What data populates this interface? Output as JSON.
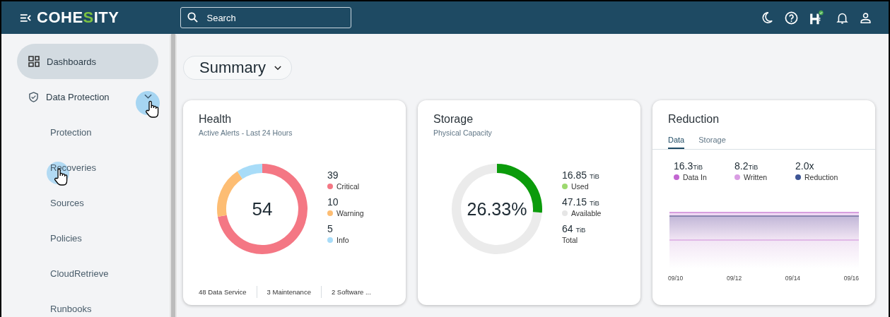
{
  "topbar": {
    "logo": {
      "parts": [
        {
          "text": "COHE",
          "accent": false
        },
        {
          "text": "S",
          "accent": true
        },
        {
          "text": "ITY",
          "accent": false
        }
      ]
    },
    "search": {
      "placeholder": "Search"
    },
    "status_ok": true
  },
  "sidebar": {
    "items": [
      {
        "label": "Dashboards",
        "selected": true
      },
      {
        "label": "Data Protection",
        "selected": false,
        "expanded": true,
        "pointer": true,
        "children": [
          {
            "label": "Protection",
            "selected": false,
            "pointer": false
          },
          {
            "label": "Recoveries",
            "selected": false,
            "pointer": true
          },
          {
            "label": "Sources",
            "selected": false,
            "pointer": false
          },
          {
            "label": "Policies",
            "selected": false,
            "pointer": false
          },
          {
            "label": "CloudRetrieve",
            "selected": false,
            "pointer": false
          },
          {
            "label": "Runbooks",
            "selected": false,
            "pointer": false
          }
        ]
      }
    ]
  },
  "summary_selector": {
    "label": "Summary"
  },
  "cards": [
    {
      "kind": "health",
      "title": "Health",
      "subtitle": "Active Alerts - Last 24 Hours",
      "center": "54",
      "legend": [
        {
          "value": "39",
          "color": "#f47784"
        },
        {
          "value": "10",
          "color": "#fdbd73"
        },
        {
          "value": "5",
          "color": "#a8dcf8"
        }
      ],
      "chart_data": {
        "type": "donut",
        "categories": [
          "Critical",
          "Warning",
          "Info"
        ],
        "values": [
          72.22,
          18.52,
          9.26
        ]
      },
      "footer": [
        "48 Data Service",
        "3 Maintenance",
        "2 Software ..."
      ]
    },
    {
      "kind": "storage",
      "title": "Storage",
      "subtitle": "Physical Capacity",
      "center": "26.33%",
      "legend": [
        {
          "value": "16.85",
          "unit": "TiB",
          "label": "Used",
          "color": "#9dd96f"
        },
        {
          "value": "47.15",
          "unit": "TiB",
          "label": "Available",
          "color": "#e6e6e6"
        },
        {
          "value": "64",
          "unit": "TiB",
          "label": "Total"
        }
      ]
    },
    {
      "kind": "reduction",
      "title": "Reduction",
      "tabs": [
        {
          "label": "Data",
          "selected": true
        },
        {
          "label": "Storage",
          "selected": false
        }
      ],
      "metrics": [
        {
          "value": "16.3",
          "unit": "TiB",
          "label": "Data In",
          "color": "#c266d1"
        },
        {
          "value": "8.2",
          "unit": "TiB",
          "label": "Written",
          "color": "#d99de3"
        },
        {
          "value": "2.0x",
          "label": "Reduction",
          "color": "#3d5595"
        }
      ],
      "x_labels": [
        "09/10",
        "09/12",
        "09/14",
        "09/16"
      ]
    }
  ]
}
